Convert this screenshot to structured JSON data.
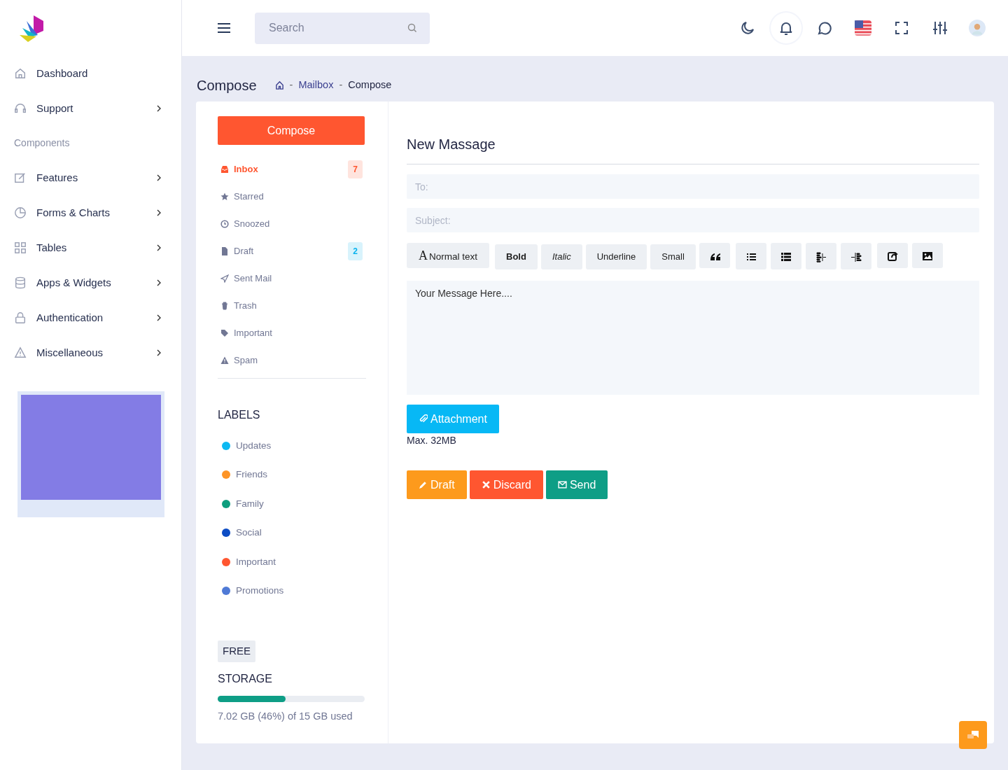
{
  "search": {
    "placeholder": "Search"
  },
  "sidebar": {
    "items": [
      {
        "kind": "link",
        "label": "Dashboard",
        "has_submenu": false
      },
      {
        "kind": "link",
        "label": "Support",
        "has_submenu": true
      },
      {
        "kind": "heading",
        "label": "Components"
      },
      {
        "kind": "link",
        "label": "Features",
        "has_submenu": true
      },
      {
        "kind": "link",
        "label": "Forms & Charts",
        "has_submenu": true
      },
      {
        "kind": "link",
        "label": "Tables",
        "has_submenu": true
      },
      {
        "kind": "link",
        "label": "Apps & Widgets",
        "has_submenu": true
      },
      {
        "kind": "link",
        "label": "Authentication",
        "has_submenu": true
      },
      {
        "kind": "link",
        "label": "Miscellaneous",
        "has_submenu": true
      }
    ]
  },
  "page": {
    "title": "Compose",
    "breadcrumb_separator": "-",
    "breadcrumb": [
      "Mailbox",
      "Compose"
    ]
  },
  "mailbox": {
    "compose_button": "Compose",
    "folders": [
      {
        "label": "Inbox",
        "selected": true,
        "badge": {
          "text": "7",
          "color": "#ff5630"
        }
      },
      {
        "label": "Starred",
        "selected": false
      },
      {
        "label": "Snoozed",
        "selected": false
      },
      {
        "label": "Draft",
        "selected": false,
        "badge": {
          "text": "2",
          "color": "#09b3ee"
        }
      },
      {
        "label": "Sent Mail",
        "selected": false
      },
      {
        "label": "Trash",
        "selected": false
      },
      {
        "label": "Important",
        "selected": false
      },
      {
        "label": "Spam",
        "selected": false
      }
    ],
    "labels_heading": "LABELS",
    "labels": [
      {
        "label": "Updates",
        "color": "#0db9f2"
      },
      {
        "label": "Friends",
        "color": "#fd9426"
      },
      {
        "label": "Family",
        "color": "#0e9e7e"
      },
      {
        "label": "Social",
        "color": "#0c4cc4"
      },
      {
        "label": "Important",
        "color": "#ff5630"
      },
      {
        "label": "Promotions",
        "color": "#4f7ad6"
      }
    ],
    "storage": {
      "plan": "FREE",
      "title": "STORAGE",
      "level": 0.46,
      "usage": "7.02 GB (46%) of 15 GB used"
    }
  },
  "compose": {
    "heading": "New Massage",
    "to": {
      "placeholder": "To:"
    },
    "subject": {
      "placeholder": "Subject:"
    },
    "toolbar": [
      {
        "kind": "text",
        "glyph": "A",
        "label": "Normal text"
      },
      {
        "kind": "bold",
        "label": "Bold"
      },
      {
        "kind": "italic",
        "label": "Italic"
      },
      {
        "kind": "plain",
        "label": "Underline"
      },
      {
        "kind": "plain",
        "label": "Small"
      },
      {
        "kind": "quote"
      },
      {
        "kind": "list"
      },
      {
        "kind": "list-thick"
      },
      {
        "kind": "outdent"
      },
      {
        "kind": "indent"
      },
      {
        "kind": "share"
      },
      {
        "kind": "image"
      }
    ],
    "message": {
      "placeholder": "Your Message Here...."
    },
    "attachment": {
      "label": "Attachment",
      "note": "Max. 32MB"
    },
    "actions": [
      {
        "kind": "draft",
        "label": "Draft"
      },
      {
        "kind": "discard",
        "label": "Discard"
      },
      {
        "kind": "send",
        "label": "Send"
      }
    ]
  }
}
